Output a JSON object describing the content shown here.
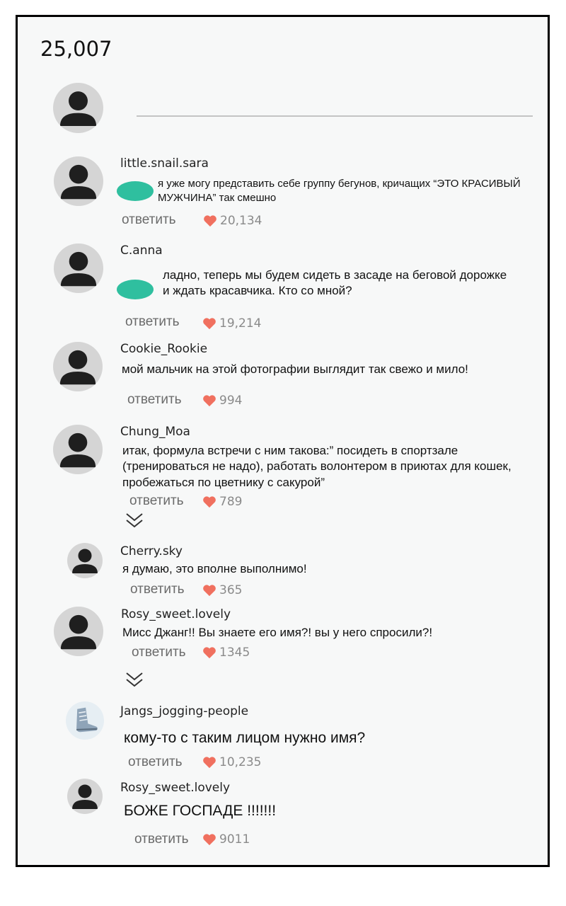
{
  "header": {
    "comment_count": "25,007"
  },
  "compose": {
    "avatar_icon": "user-silhouette-icon"
  },
  "colors": {
    "heart": "#f0705f",
    "blob": "#2fbf9f",
    "avatar_bg": "#d5d5d5"
  },
  "comments": [
    {
      "username": "little.snail.sara",
      "text": "я уже могу представить себе группу бегунов, кричащих “ЭТО КРАСИВЫЙ МУЖЧИНА” так смешно",
      "reply_label": "ответить",
      "likes": "20,134"
    },
    {
      "username": "C.anna",
      "text": "ладно, теперь мы будем сидеть в засаде на беговой дорожке и ждать красавчика. Кто со мной?",
      "reply_label": "ответить",
      "likes": "19,214"
    },
    {
      "username": "Cookie_Rookie",
      "text": "мой мальчик на этой фотографии выглядит так свежо и мило!",
      "reply_label": "ответить",
      "likes": "994"
    },
    {
      "username": "Chung_Moa",
      "text": "итак, формула встречи с ним такова:” посидеть в спортзале (тренироваться не надо), работать волонтером в приютах для кошек, пробежаться по цветнику с сакурой”",
      "reply_label": "ответить",
      "likes": "789",
      "has_replies_toggle": true
    },
    {
      "username": "Cherry.sky",
      "text": "я думаю, это вполне выполнимо!",
      "reply_label": "ответить",
      "likes": "365"
    },
    {
      "username": "Rosy_sweet.lovely",
      "text": "Мисс Джанг!! Вы знаете его имя?! вы у него спросили?!",
      "reply_label": "ответить",
      "likes": "1345",
      "has_replies_toggle": true
    },
    {
      "username": "Jangs_jogging-people",
      "text": "кому-то с таким лицом нужно имя?",
      "reply_label": "ответить",
      "likes": "10,235",
      "avatar_icon": "sneaker-icon"
    },
    {
      "username": "Rosy_sweet.lovely",
      "text": "БОЖЕ ГОСПАДЕ !!!!!!!",
      "reply_label": "ответить",
      "likes": "9011"
    }
  ]
}
